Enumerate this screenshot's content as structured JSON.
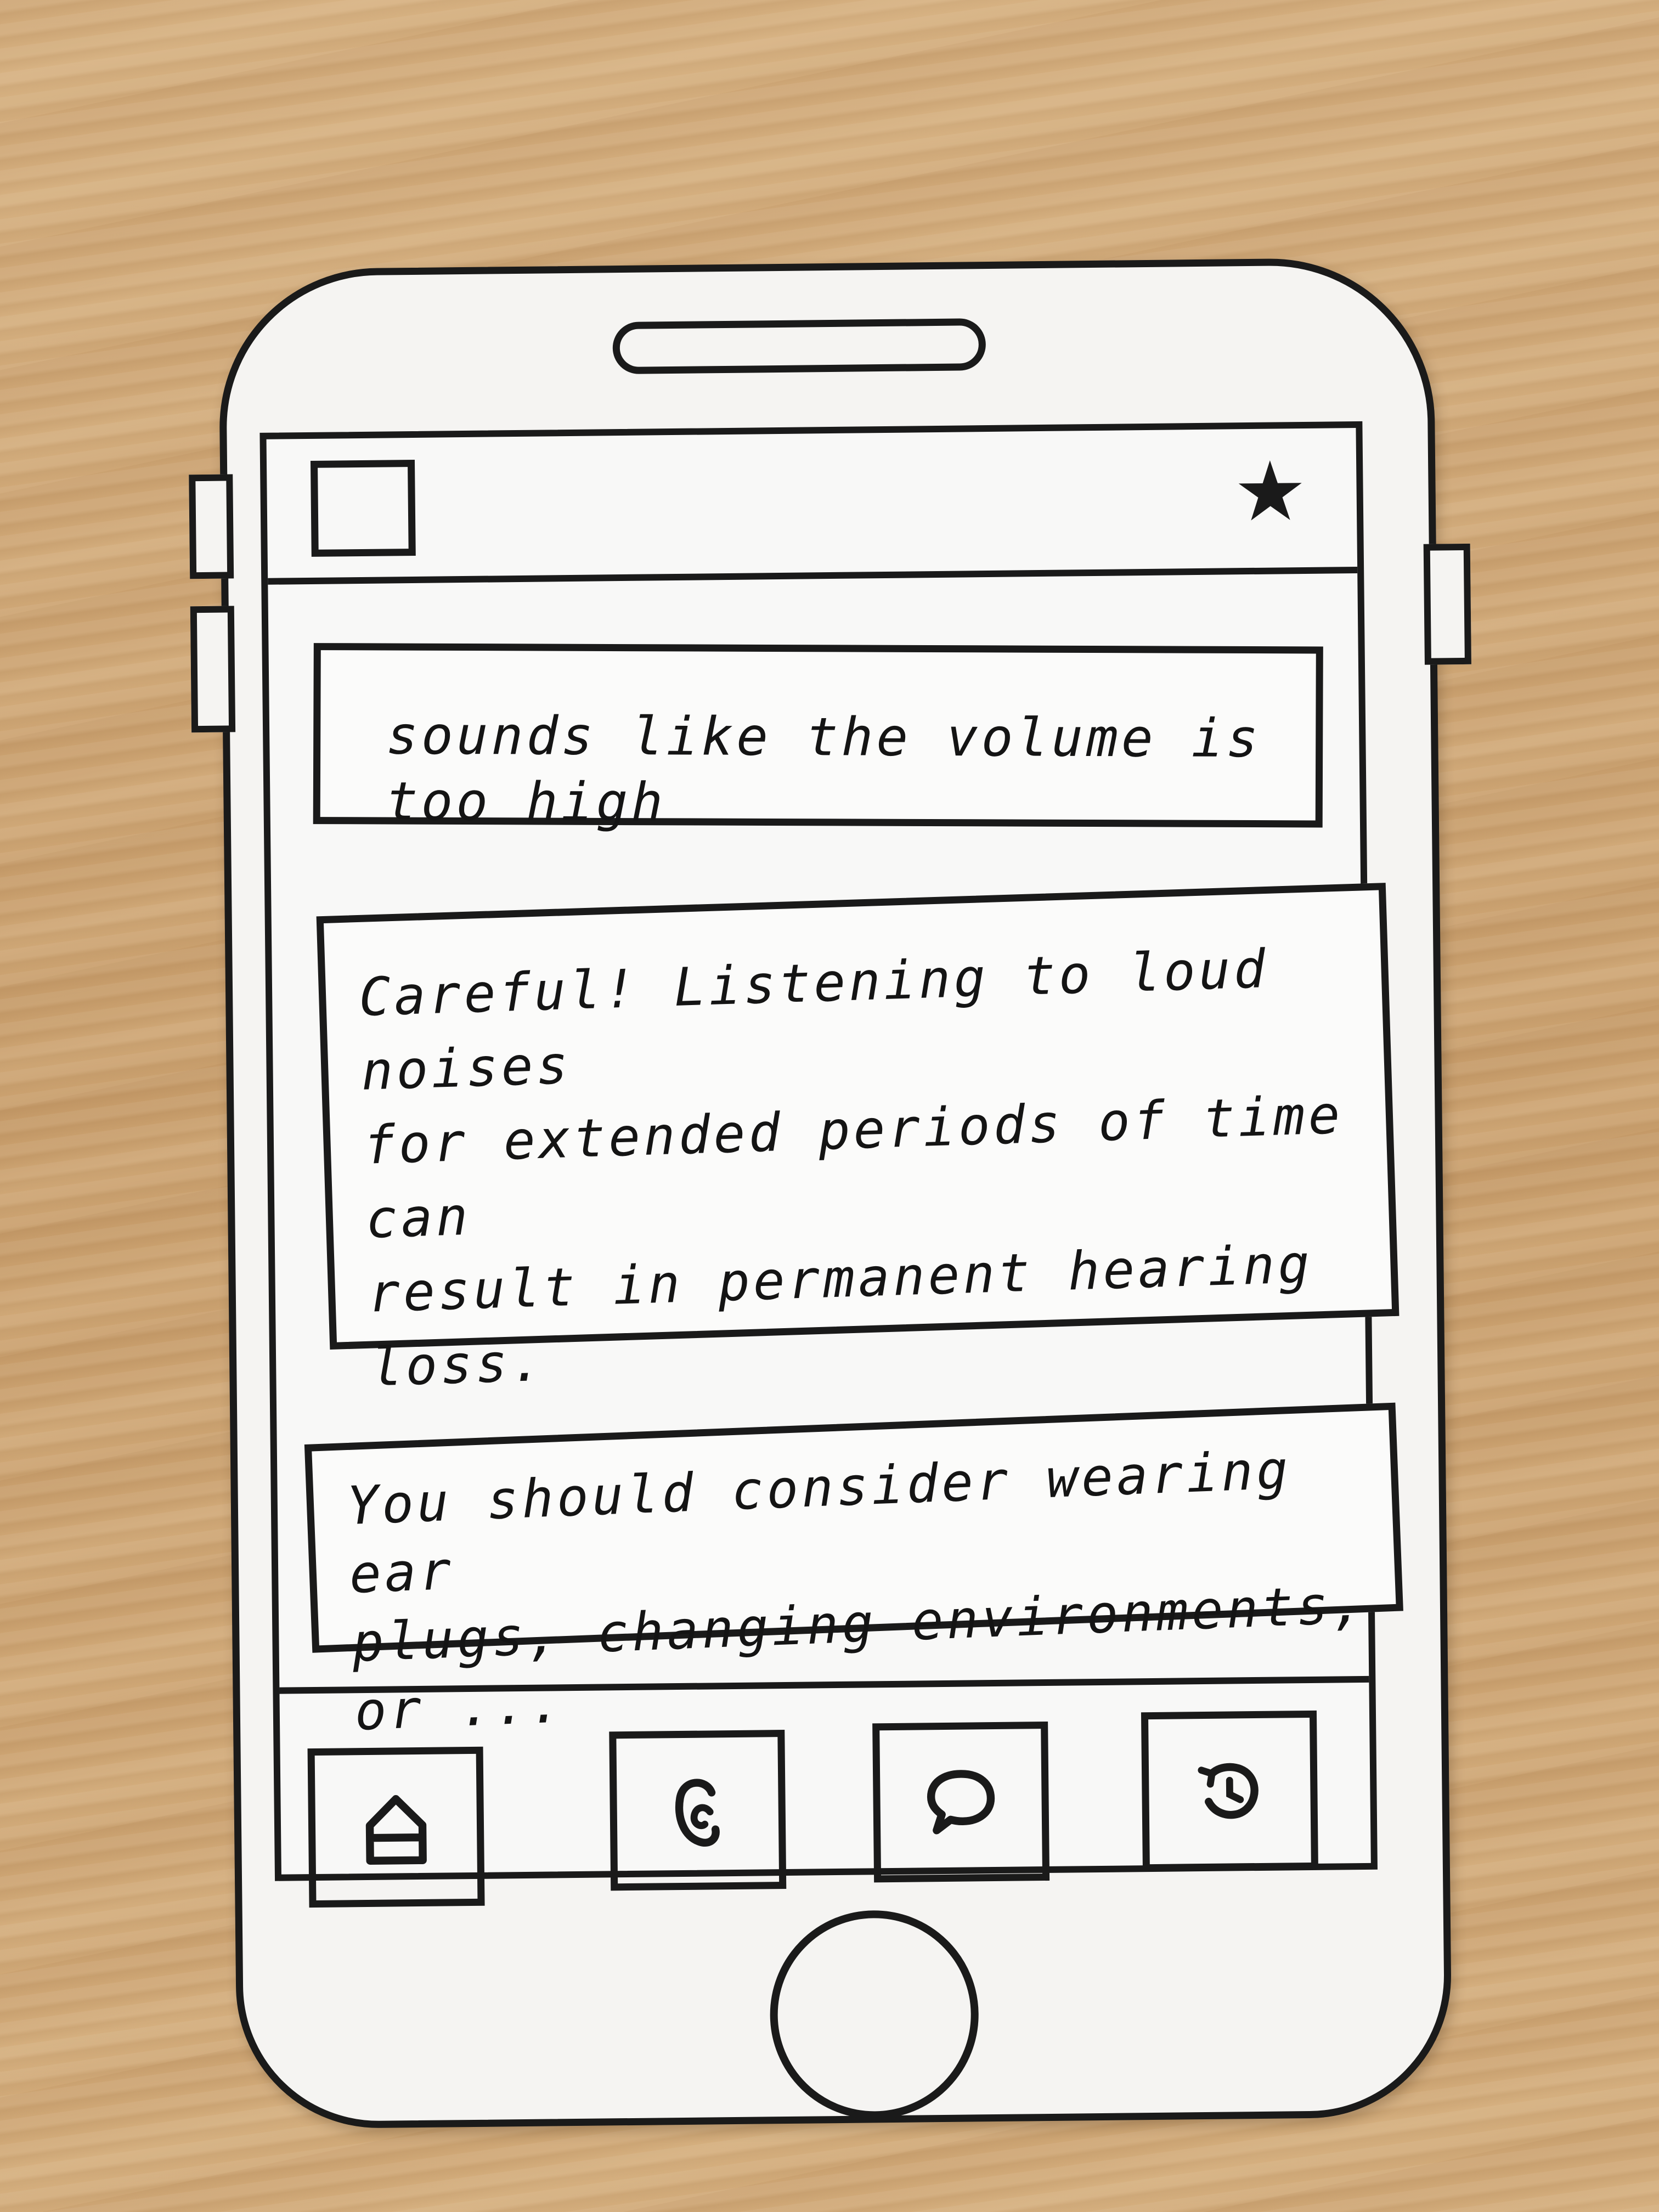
{
  "screen": {
    "header": {
      "menu_icon": "square-menu-icon",
      "favorite_icon": "star-icon",
      "favorite_glyph": "★"
    },
    "messages": [
      {
        "text": "sounds like the volume is too high"
      },
      {
        "text": "Careful! Listening to loud noises\nfor extended periods of time can\nresult in permanent hearing loss."
      },
      {
        "text": "You should consider wearing ear\nplugs, changing environments, or ..."
      }
    ],
    "nav": [
      {
        "icon": "home-icon"
      },
      {
        "icon": "ear-icon"
      },
      {
        "icon": "chat-icon"
      },
      {
        "icon": "history-icon"
      }
    ]
  },
  "colors": {
    "ink": "#1a1a1a",
    "paper": "#f5f4f2",
    "table": "#cfa877"
  }
}
